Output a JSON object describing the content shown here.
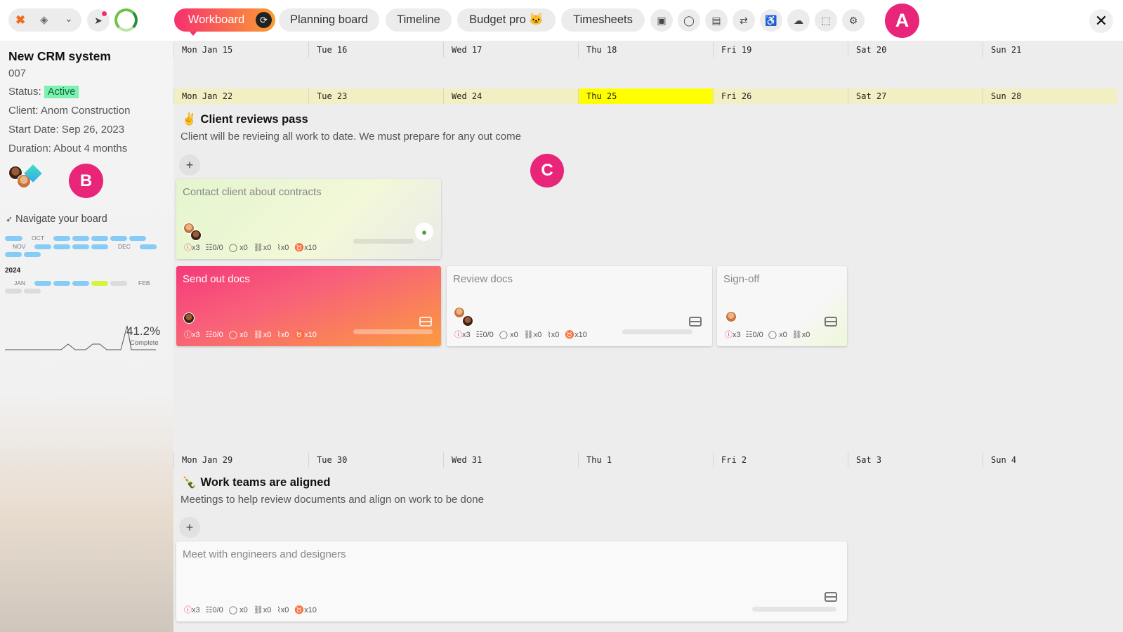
{
  "topbar": {
    "tabs": [
      {
        "label": "Workboard",
        "active": true
      },
      {
        "label": "Planning board"
      },
      {
        "label": "Timeline"
      },
      {
        "label": "Budget pro 🐱"
      },
      {
        "label": "Timesheets"
      }
    ],
    "account_initial": "A",
    "close_glyph": "✕"
  },
  "sidebar": {
    "project_title": "New CRM system",
    "project_code": "007",
    "status_label": "Status:",
    "status_value": "Active",
    "client": "Client: Anom Construction",
    "start_date": "Start Date: Sep 26, 2023",
    "duration": "Duration: About 4 months",
    "member_initial": "B",
    "navigate_label": "Navigate your board",
    "month_labels": {
      "oct": "OCT",
      "nov": "NOV",
      "dec": "DEC",
      "jan": "JAN",
      "feb": "FEB"
    },
    "year_label": "2024",
    "completion_value": "41.2%",
    "completion_label": "Complete"
  },
  "board": {
    "week1": [
      "Mon Jan 15",
      "Tue 16",
      "Wed 17",
      "Thu 18",
      "Fri 19",
      "Sat 20",
      "Sun 21"
    ],
    "week2": [
      "Mon Jan 22",
      "Tue 23",
      "Wed 24",
      "Thu 25",
      "Fri 26",
      "Sat 27",
      "Sun 28"
    ],
    "week3": [
      "Mon Jan 29",
      "Tue 30",
      "Wed 31",
      "Thu 1",
      "Fri 2",
      "Sat 3",
      "Sun 4"
    ],
    "today": "Thu 25",
    "milestone1": {
      "emoji": "✌",
      "title": "Client reviews pass",
      "subtitle": "Client will be revieing all work to date. We must prepare for any out come"
    },
    "milestone2": {
      "emoji": "🍾",
      "title": "Work teams are aligned",
      "subtitle": "Meetings to help review documents and align on work to be done"
    },
    "annotation_c": "C",
    "add_glyph": "+",
    "cards": [
      {
        "title": "Contact client about contracts",
        "alerts": "x3",
        "checklist": "0/0",
        "comments": "x0",
        "links": "x0",
        "attachments": "x0",
        "points": "x10"
      },
      {
        "title": "Send out docs",
        "alerts": "x3",
        "checklist": "0/0",
        "comments": "x0",
        "links": "x0",
        "attachments": "x0",
        "points": "x10"
      },
      {
        "title": "Review docs",
        "alerts": "x3",
        "checklist": "0/0",
        "comments": "x0",
        "links": "x0",
        "attachments": "x0",
        "points": "x10"
      },
      {
        "title": "Sign-off",
        "alerts": "x3",
        "checklist": "0/0",
        "comments": "x0",
        "links": "x0"
      },
      {
        "title": "Meet with engineers and designers",
        "alerts": "x3",
        "checklist": "0/0",
        "comments": "x0",
        "links": "x0",
        "attachments": "x0",
        "points": "x10"
      }
    ]
  },
  "colors": {
    "accent_pink": "#f6306f",
    "accent_orange": "#fb9d32",
    "today": "#ffff00",
    "status_active": "#7ef0b0",
    "timeline_bar": "#86ccf6"
  }
}
